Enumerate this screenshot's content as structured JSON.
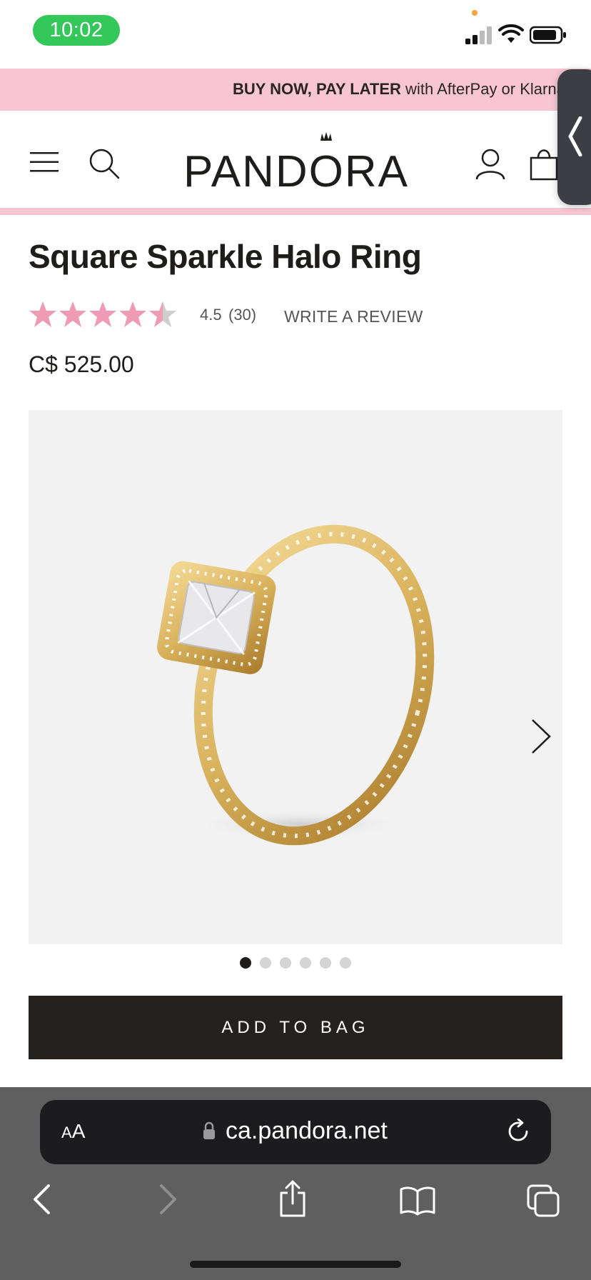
{
  "status_bar": {
    "time": "10:02"
  },
  "promo": {
    "bold": "BUY NOW, PAY LATER",
    "rest": " with AfterPay or Klarna"
  },
  "header": {
    "logo_text": "PANDORA"
  },
  "product": {
    "title": "Square Sparkle Halo Ring",
    "rating": "4.5",
    "review_count": "(30)",
    "write_review": "WRITE A REVIEW",
    "price": "C$ 525.00",
    "stars_filled": 4.5,
    "stars_total": 5
  },
  "gallery": {
    "image_count": 6,
    "active_index": 0
  },
  "actions": {
    "add_to_bag": "ADD TO BAG"
  },
  "browser": {
    "aa_label_small": "A",
    "aa_label_large": "A",
    "url": "ca.pandora.net"
  },
  "colors": {
    "accent_pink": "#f8c6d3",
    "star_pink": "#f09bb4",
    "button_dark": "#25211e",
    "status_green": "#34c759"
  }
}
